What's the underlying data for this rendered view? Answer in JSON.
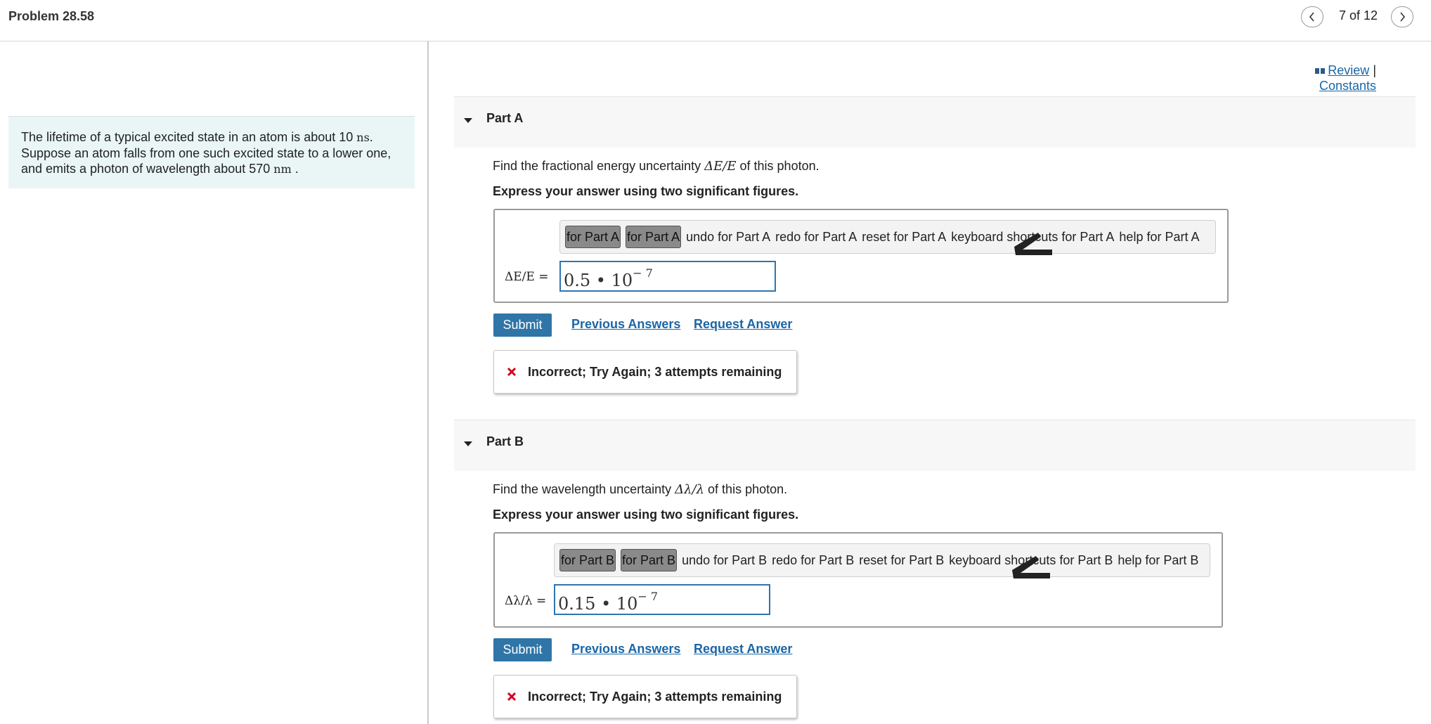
{
  "header": {
    "title": "Problem 28.58",
    "counter": "7 of 12"
  },
  "intro": {
    "text_1": "The lifetime of a typical excited state in an atom is about 10 ",
    "unit_1": "ns",
    "text_2": ". Suppose an atom falls from one such excited state to a lower one, and emits a photon of wavelength about 570 ",
    "unit_2": "nm",
    "text_3": " ."
  },
  "links": {
    "review": "Review",
    "separator": "|",
    "constants": "Constants"
  },
  "partA": {
    "label": "Part A",
    "question_prefix": "Find the fractional energy uncertainty ",
    "question_math": "ΔE/E",
    "question_suffix": " of this photon.",
    "instruction": "Express your answer using two significant figures.",
    "toolbar": {
      "btn1": "for Part A",
      "btn2": "for Part A",
      "undo": "undo for Part A",
      "redo": "redo for Part A",
      "reset": "reset for Part A",
      "keyboard": "keyboard shortcuts for Part A",
      "help": "help for Part A"
    },
    "eq_label": "ΔE/E =",
    "answer_mantissa": "0.5 • 10",
    "answer_exponent": "− 7",
    "submit": "Submit",
    "previous": "Previous Answers",
    "request": "Request Answer",
    "feedback": "Incorrect; Try Again; 3 attempts remaining"
  },
  "partB": {
    "label": "Part B",
    "question_prefix": "Find the wavelength uncertainty ",
    "question_math": "Δλ/λ",
    "question_suffix": " of this photon.",
    "instruction": "Express your answer using two significant figures.",
    "toolbar": {
      "btn1": "for Part B",
      "btn2": "for Part B",
      "undo": "undo for Part B",
      "redo": "redo for Part B",
      "reset": "reset for Part B",
      "keyboard": "keyboard shortcuts for Part B",
      "help": "help for Part B"
    },
    "eq_label": "Δλ/λ =",
    "answer_mantissa": "0.15 • 10",
    "answer_exponent": "− 7",
    "submit": "Submit",
    "previous": "Previous Answers",
    "request": "Request Answer",
    "feedback": "Incorrect; Try Again; 3 attempts remaining"
  },
  "colors": {
    "link": "#1a66a6",
    "submit": "#2f75a7",
    "intro_bg": "#e9f6f5",
    "error": "#d0021b"
  },
  "icons": {
    "prev": "chevron-left-icon",
    "next": "chevron-right-icon",
    "book": "book-icon",
    "error": "x-icon",
    "collapse": "caret-down-icon"
  }
}
